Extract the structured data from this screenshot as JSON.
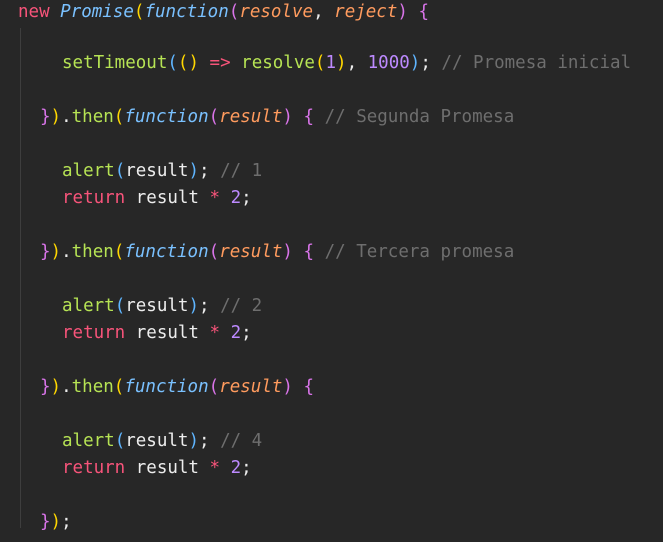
{
  "code": {
    "lines": [
      {
        "tokens": [
          {
            "t": "new",
            "c": "kw-new"
          },
          {
            "t": " ",
            "c": "plain"
          },
          {
            "t": "Promise",
            "c": "class"
          },
          {
            "t": "(",
            "c": "paren1"
          },
          {
            "t": "function",
            "c": "func-kw"
          },
          {
            "t": "(",
            "c": "paren2"
          },
          {
            "t": "resolve",
            "c": "param"
          },
          {
            "t": ", ",
            "c": "punct"
          },
          {
            "t": "reject",
            "c": "param"
          },
          {
            "t": ")",
            "c": "paren2"
          },
          {
            "t": " ",
            "c": "plain"
          },
          {
            "t": "{",
            "c": "paren2"
          }
        ]
      },
      {
        "tokens": [
          {
            "t": "setTimeout",
            "c": "call"
          },
          {
            "t": "(",
            "c": "paren3"
          },
          {
            "t": "()",
            "c": "paren1"
          },
          {
            "t": " ",
            "c": "plain"
          },
          {
            "t": "=>",
            "c": "arrow"
          },
          {
            "t": " ",
            "c": "plain"
          },
          {
            "t": "resolve",
            "c": "call"
          },
          {
            "t": "(",
            "c": "paren1"
          },
          {
            "t": "1",
            "c": "num"
          },
          {
            "t": ")",
            "c": "paren1"
          },
          {
            "t": ", ",
            "c": "punct"
          },
          {
            "t": "1000",
            "c": "num"
          },
          {
            "t": ")",
            "c": "paren3"
          },
          {
            "t": "; ",
            "c": "punct"
          },
          {
            "t": "// Promesa inicial",
            "c": "comment"
          }
        ]
      },
      {
        "tokens": [
          {
            "t": "}",
            "c": "paren2"
          },
          {
            "t": ")",
            "c": "paren1"
          },
          {
            "t": ".",
            "c": "punct"
          },
          {
            "t": "then",
            "c": "then"
          },
          {
            "t": "(",
            "c": "paren1"
          },
          {
            "t": "function",
            "c": "func-kw"
          },
          {
            "t": "(",
            "c": "paren2"
          },
          {
            "t": "result",
            "c": "param"
          },
          {
            "t": ")",
            "c": "paren2"
          },
          {
            "t": " ",
            "c": "plain"
          },
          {
            "t": "{",
            "c": "paren2"
          },
          {
            "t": " ",
            "c": "plain"
          },
          {
            "t": "// Segunda Promesa",
            "c": "comment"
          }
        ]
      },
      {
        "tokens": [
          {
            "t": "alert",
            "c": "call"
          },
          {
            "t": "(",
            "c": "paren3"
          },
          {
            "t": "result",
            "c": "plain"
          },
          {
            "t": ")",
            "c": "paren3"
          },
          {
            "t": "; ",
            "c": "punct"
          },
          {
            "t": "// 1",
            "c": "comment"
          }
        ]
      },
      {
        "tokens": [
          {
            "t": "return",
            "c": "kw-return"
          },
          {
            "t": " result ",
            "c": "plain"
          },
          {
            "t": "*",
            "c": "op"
          },
          {
            "t": " ",
            "c": "plain"
          },
          {
            "t": "2",
            "c": "num"
          },
          {
            "t": ";",
            "c": "punct"
          }
        ]
      },
      {
        "tokens": [
          {
            "t": "}",
            "c": "paren2"
          },
          {
            "t": ")",
            "c": "paren1"
          },
          {
            "t": ".",
            "c": "punct"
          },
          {
            "t": "then",
            "c": "then"
          },
          {
            "t": "(",
            "c": "paren1"
          },
          {
            "t": "function",
            "c": "func-kw"
          },
          {
            "t": "(",
            "c": "paren2"
          },
          {
            "t": "result",
            "c": "param"
          },
          {
            "t": ")",
            "c": "paren2"
          },
          {
            "t": " ",
            "c": "plain"
          },
          {
            "t": "{",
            "c": "paren2"
          },
          {
            "t": " ",
            "c": "plain"
          },
          {
            "t": "// Tercera promesa",
            "c": "comment"
          }
        ]
      },
      {
        "tokens": [
          {
            "t": "alert",
            "c": "call"
          },
          {
            "t": "(",
            "c": "paren3"
          },
          {
            "t": "result",
            "c": "plain"
          },
          {
            "t": ")",
            "c": "paren3"
          },
          {
            "t": "; ",
            "c": "punct"
          },
          {
            "t": "// 2",
            "c": "comment"
          }
        ]
      },
      {
        "tokens": [
          {
            "t": "return",
            "c": "kw-return"
          },
          {
            "t": " result ",
            "c": "plain"
          },
          {
            "t": "*",
            "c": "op"
          },
          {
            "t": " ",
            "c": "plain"
          },
          {
            "t": "2",
            "c": "num"
          },
          {
            "t": ";",
            "c": "punct"
          }
        ]
      },
      {
        "tokens": [
          {
            "t": "}",
            "c": "paren2"
          },
          {
            "t": ")",
            "c": "paren1"
          },
          {
            "t": ".",
            "c": "punct"
          },
          {
            "t": "then",
            "c": "then"
          },
          {
            "t": "(",
            "c": "paren1"
          },
          {
            "t": "function",
            "c": "func-kw"
          },
          {
            "t": "(",
            "c": "paren2"
          },
          {
            "t": "result",
            "c": "param"
          },
          {
            "t": ")",
            "c": "paren2"
          },
          {
            "t": " ",
            "c": "plain"
          },
          {
            "t": "{",
            "c": "paren2"
          }
        ]
      },
      {
        "tokens": [
          {
            "t": "alert",
            "c": "call"
          },
          {
            "t": "(",
            "c": "paren3"
          },
          {
            "t": "result",
            "c": "plain"
          },
          {
            "t": ")",
            "c": "paren3"
          },
          {
            "t": "; ",
            "c": "punct"
          },
          {
            "t": "// 4",
            "c": "comment"
          }
        ]
      },
      {
        "tokens": [
          {
            "t": "return",
            "c": "kw-return"
          },
          {
            "t": " result ",
            "c": "plain"
          },
          {
            "t": "*",
            "c": "op"
          },
          {
            "t": " ",
            "c": "plain"
          },
          {
            "t": "2",
            "c": "num"
          },
          {
            "t": ";",
            "c": "punct"
          }
        ]
      },
      {
        "tokens": [
          {
            "t": "}",
            "c": "paren2"
          },
          {
            "t": ")",
            "c": "paren1"
          },
          {
            "t": ";",
            "c": "punct"
          }
        ]
      }
    ]
  },
  "colors": {
    "background": "#272727",
    "keyword": "#f7547a",
    "function_keyword": "#7ac1ff",
    "parameter": "#ff9b5e",
    "call": "#b6e354",
    "number": "#bd8aff",
    "comment": "#6e6e6e"
  }
}
